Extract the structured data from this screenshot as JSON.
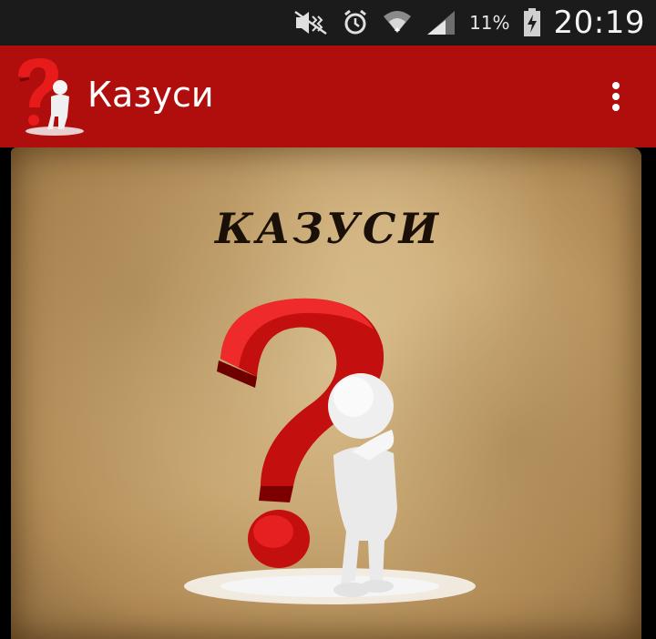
{
  "status_bar": {
    "battery_percent": "11%",
    "time": "20:19",
    "icons": [
      "mute-icon",
      "alarm-icon",
      "wifi-icon",
      "signal-icon",
      "battery-charging-icon"
    ]
  },
  "app_bar": {
    "title": "Казуси",
    "logo_icon": "question-figure-logo-icon",
    "overflow_icon": "more-vert-icon",
    "color": "#b00d0d"
  },
  "main": {
    "heading": "КАЗУСИ",
    "image_icon": "question-mark-figure-illustration"
  }
}
